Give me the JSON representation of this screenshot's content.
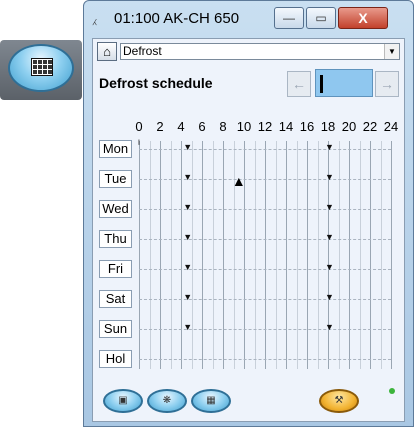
{
  "window": {
    "title": "01:100 AK-CH 650",
    "close_symbol": "X",
    "minimize_symbol": "—",
    "maximize_symbol": "▭"
  },
  "toolbar": {
    "menu_selected": "Defrost"
  },
  "page": {
    "heading": "Defrost schedule",
    "nav_prev": "←",
    "nav_next": "→"
  },
  "hours": [
    "0",
    "2",
    "4",
    "6",
    "8",
    "10",
    "12",
    "14",
    "16",
    "18",
    "20",
    "22",
    "24"
  ],
  "days": [
    "Mon",
    "Tue",
    "Wed",
    "Thu",
    "Fri",
    "Sat",
    "Sun",
    "Hol"
  ],
  "defrost_times_hours": [
    4.5,
    18
  ],
  "mon_start_marker_hour": 0,
  "cursor": {
    "day": "Tue",
    "hour": 9.5
  },
  "icons": {
    "side": "schedule-grid-icon",
    "home": "home-icon",
    "bottom": [
      "unit-icon",
      "fan-icon",
      "schedule-grid-icon",
      "wrench-icon"
    ]
  },
  "colors": {
    "accent_blue": "#8fc7ef",
    "status_green": "#3cb43c"
  }
}
